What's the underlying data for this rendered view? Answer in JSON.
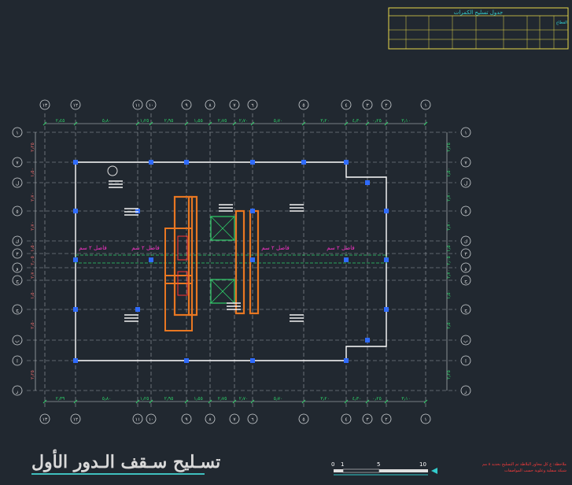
{
  "drawing": {
    "title": "تسـليح سـقف الـدور الأول",
    "note_lines": [
      "ملاحظة: ع كل محاور البلاطة تم التسليح بحديد ٨ مم",
      "شبكة سفلية وعلوية حسب المواصفات"
    ],
    "colors": {
      "background": "#212830",
      "grid_line": "#9aa0a6",
      "outline": "#ffffff",
      "beam": "#e87722",
      "column": "#2f6bff",
      "green": "#2fd06a",
      "magenta": "#ff33cc",
      "table_border": "#e8d84a",
      "cyan": "#33cccc"
    }
  },
  "schedule_table": {
    "title": "جدول تسليح الكمرات",
    "header_right": "القطاع"
  },
  "grid": {
    "vertical_labels": [
      "١٣",
      "١٢",
      "١١",
      "١٠",
      "٩",
      "٨",
      "٧",
      "٦",
      "٥",
      "٤",
      "٣",
      "٢",
      "١"
    ],
    "horizontal_labels": [
      "١",
      "٧",
      "ل",
      "٥",
      "ك",
      "٣",
      "و",
      "ح",
      "ج",
      "ب",
      "ا",
      "ز"
    ]
  },
  "dimensions_top": [
    "٢٫٤٥",
    "٥٫٨٠",
    "١٫٢٥",
    "٢٫٩٥",
    "١٫٥٥",
    "٢٫٧٥",
    "٢٫٧٠",
    "٥٫٧٠",
    "٣٫٢٠",
    "٤٫٣٠",
    "٠٫٢٥",
    "٣٫١٠"
  ],
  "dimensions_bottom": [
    "٢٫٣٩",
    "٥٫٨٠",
    "١٫٢٥",
    "٢٫٩٥",
    "١٫٥٥",
    "٢٫٧٥",
    "٢٫٧٠",
    "٥٫٧٠",
    "٣٫٢٠",
    "٤٫٣٠",
    "٠٫٢٥",
    "٣٫١٠"
  ],
  "dimensions_left": [
    "٢٫٢٥",
    "١٫٥٠",
    "٢٫٧٠",
    "٢٫٧٠",
    "١٫٥٠",
    "٢٫٠٥",
    "٢٫٧٠",
    "١٫٥٠",
    "٢٫٥٠",
    "٢٫٢٥"
  ],
  "beam_labels": [
    "فاصل ٢ سم",
    "فاصل ٢ سم",
    "فاصل ٢ سم",
    "فاصل ٢ سم"
  ],
  "scale_bar": {
    "labels": [
      "0",
      "1",
      "5",
      "10"
    ]
  }
}
